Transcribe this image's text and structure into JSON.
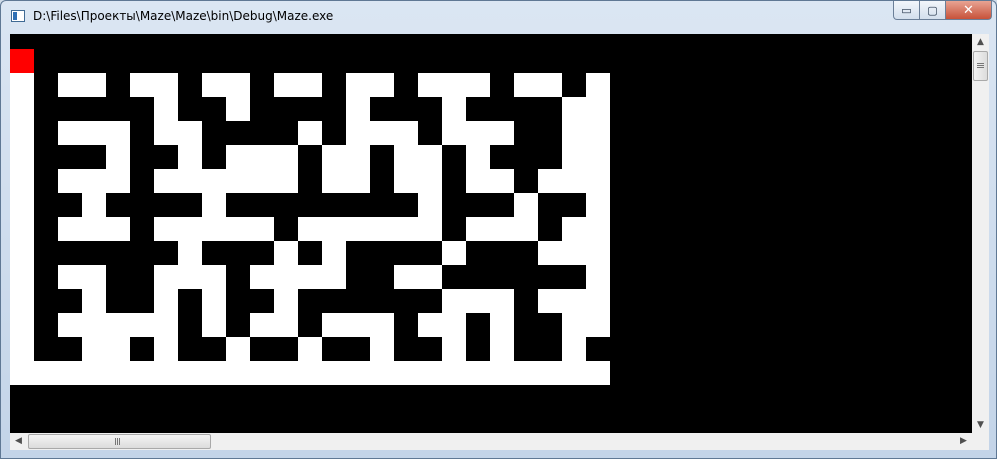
{
  "window": {
    "title": "D:\\Files\\Проекты\\Maze\\Maze\\bin\\Debug\\Maze.exe",
    "icon": "console-app-icon",
    "buttons": {
      "minimize": "▭",
      "maximize": "▢",
      "close": "✕"
    }
  },
  "colors": {
    "wall": "#000000",
    "path": "#ffffff",
    "player": "#ff0000",
    "background": "#000000"
  },
  "maze": {
    "columns": 25,
    "rows": 14,
    "player": {
      "row": 0,
      "col": 0
    },
    "grid": [
      "P########################",
      " #  #  #  #  #  #   #  # ",
      " ##### ## #### ### ####  ",
      " #   #  #### #   #   ##  ",
      " ### ## #   #  #  # ###  ",
      " #   #      #  #  #  #   ",
      " ## #### ######## ### ## ",
      " #   #     #      #   #  ",
      " ###### ### # #### ###   ",
      " #  ##   #    ##  ###### ",
      " ## ## # ## ######   #   ",
      " #     # #  #   #  # ##  ",
      " ##  # ## ## ## ## # ## #",
      "                         "
    ]
  },
  "scrollbars": {
    "vertical": {
      "up": "▲",
      "down": "▼",
      "position": 0.0
    },
    "horizontal": {
      "left": "◀",
      "right": "▶",
      "position": 0.0
    }
  }
}
